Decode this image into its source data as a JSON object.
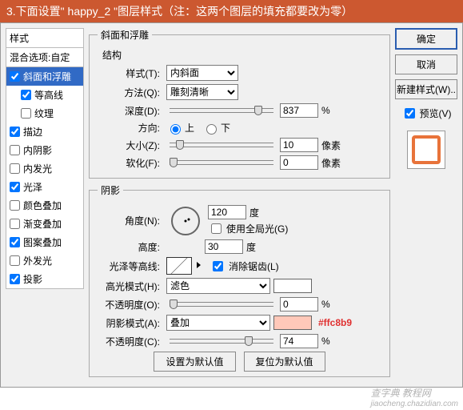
{
  "header_text": "3.下面设置\" happy_2 \"图层样式（注：这两个图层的填充都要改为零）",
  "left": {
    "styles_label": "样式",
    "blend_label": "混合选项:自定",
    "items": [
      {
        "label": "斜面和浮雕",
        "checked": true,
        "selected": true,
        "sub": false
      },
      {
        "label": "等高线",
        "checked": true,
        "selected": false,
        "sub": true
      },
      {
        "label": "纹理",
        "checked": false,
        "selected": false,
        "sub": true
      },
      {
        "label": "描边",
        "checked": true,
        "selected": false,
        "sub": false
      },
      {
        "label": "内阴影",
        "checked": false,
        "selected": false,
        "sub": false
      },
      {
        "label": "内发光",
        "checked": false,
        "selected": false,
        "sub": false
      },
      {
        "label": "光泽",
        "checked": true,
        "selected": false,
        "sub": false
      },
      {
        "label": "颜色叠加",
        "checked": false,
        "selected": false,
        "sub": false
      },
      {
        "label": "渐变叠加",
        "checked": false,
        "selected": false,
        "sub": false
      },
      {
        "label": "图案叠加",
        "checked": true,
        "selected": false,
        "sub": false
      },
      {
        "label": "外发光",
        "checked": false,
        "selected": false,
        "sub": false
      },
      {
        "label": "投影",
        "checked": true,
        "selected": false,
        "sub": false
      }
    ]
  },
  "right": {
    "ok": "确定",
    "cancel": "取消",
    "new_style": "新建样式(W)..",
    "preview_label": "预览(V)",
    "preview_checked": true
  },
  "main": {
    "title": "斜面和浮雕",
    "structure_legend": "结构",
    "style_label": "样式(T):",
    "style_value": "内斜面",
    "technique_label": "方法(Q):",
    "technique_value": "雕刻清晰",
    "depth_label": "深度(D):",
    "depth_value": "837",
    "depth_unit": "%",
    "direction_label": "方向:",
    "direction_up": "上",
    "direction_down": "下",
    "size_label": "大小(Z):",
    "size_value": "10",
    "size_unit": "像素",
    "soften_label": "软化(F):",
    "soften_value": "0",
    "soften_unit": "像素",
    "shading_legend": "阴影",
    "angle_label": "角度(N):",
    "angle_value": "120",
    "angle_unit": "度",
    "global_light": "使用全局光(G)",
    "global_light_checked": false,
    "altitude_label": "高度:",
    "altitude_value": "30",
    "altitude_unit": "度",
    "gloss_contour_label": "光泽等高线:",
    "antialias_label": "消除锯齿(L)",
    "antialias_checked": true,
    "highlight_mode_label": "高光模式(H):",
    "highlight_mode_value": "滤色",
    "highlight_opacity_label": "不透明度(O):",
    "highlight_opacity_value": "0",
    "highlight_opacity_unit": "%",
    "shadow_mode_label": "阴影模式(A):",
    "shadow_mode_value": "叠加",
    "shadow_hex": "#ffc8b9",
    "shadow_opacity_label": "不透明度(C):",
    "shadow_opacity_value": "74",
    "shadow_opacity_unit": "%",
    "set_default": "设置为默认值",
    "reset_default": "复位为默认值"
  },
  "watermark_main": "查字典 教程网",
  "watermark_sub": "jiaocheng.chazidian.com"
}
